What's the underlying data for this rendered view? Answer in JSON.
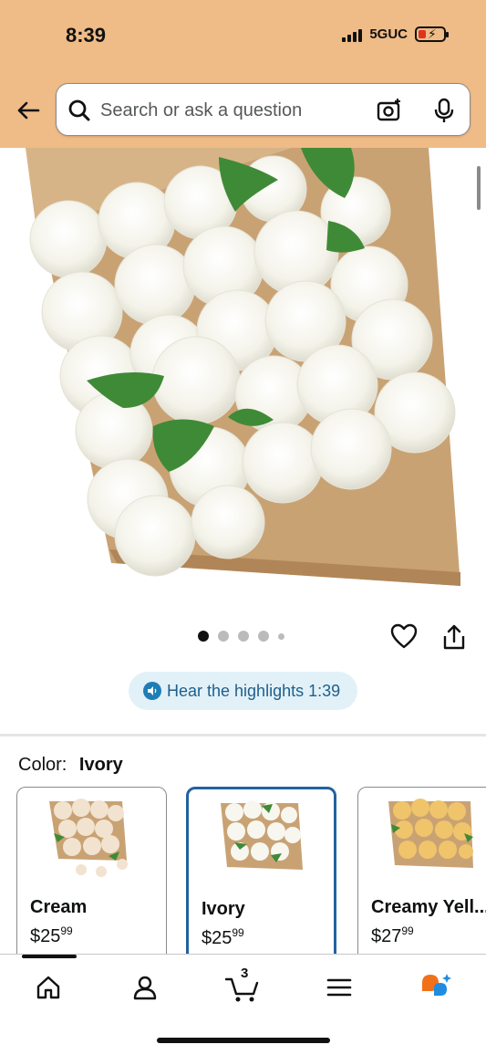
{
  "status_bar": {
    "time": "8:39",
    "network": "5GUC"
  },
  "search": {
    "placeholder": "Search or ask a question"
  },
  "icons": {
    "back": "back-arrow-icon",
    "search": "search-icon",
    "camera": "camera-icon",
    "mic": "microphone-icon",
    "heart": "heart-icon",
    "share": "share-icon",
    "speaker": "speaker-icon",
    "home": "home-icon",
    "account": "account-icon",
    "cart": "cart-icon",
    "menu": "menu-icon",
    "rufus": "rufus-icon"
  },
  "gallery": {
    "image_count": 5,
    "active_index": 0
  },
  "hear_highlights": {
    "label": "Hear the highlights 1:39"
  },
  "color": {
    "label": "Color:",
    "value": "Ivory"
  },
  "swatches": [
    {
      "name": "Cream",
      "price_dollars": "$25",
      "price_cents": "99",
      "selected": false
    },
    {
      "name": "Ivory",
      "price_dollars": "$25",
      "price_cents": "99",
      "selected": true
    },
    {
      "name": "Creamy Yell...",
      "price_dollars": "$27",
      "price_cents": "99",
      "selected": false
    }
  ],
  "bottom_nav": {
    "cart_count": "3"
  },
  "colors": {
    "header_bg": "#efbb87",
    "accent_blue": "#2162a1",
    "highlight_bg": "#e2f1f8",
    "rufus_orange": "#f0711a",
    "rufus_blue": "#1f8ce0"
  }
}
